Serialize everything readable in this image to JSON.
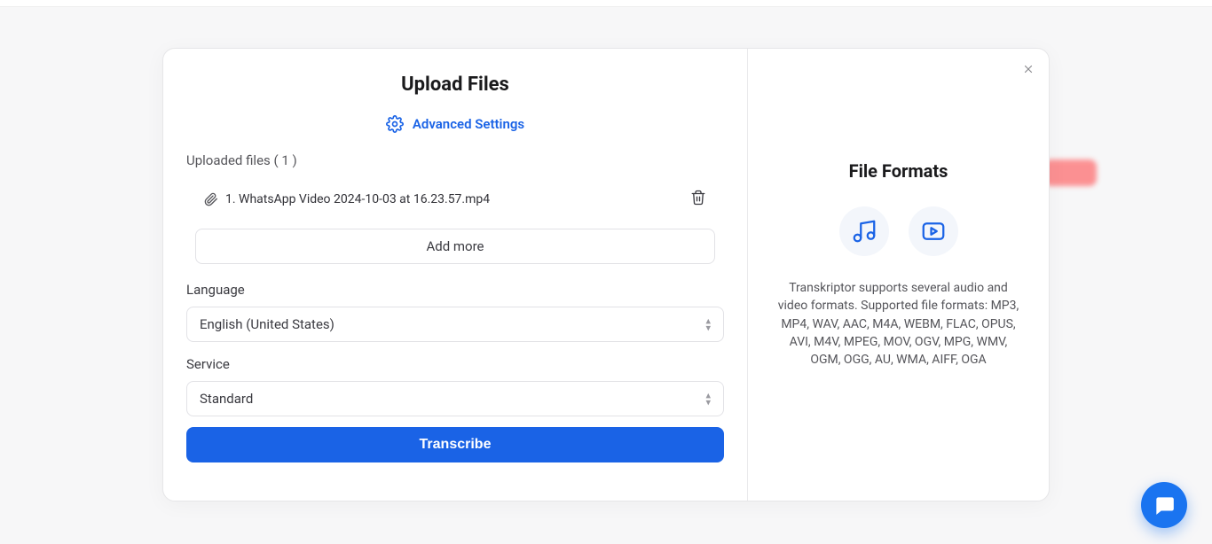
{
  "modal": {
    "title": "Upload Files",
    "advanced_settings": "Advanced Settings",
    "uploaded_files_label": "Uploaded files ( 1 )",
    "file_name": "1. WhatsApp Video 2024-10-03 at 16.23.57.mp4",
    "add_more": "Add more",
    "language_label": "Language",
    "language_value": "English (United States)",
    "service_label": "Service",
    "service_value": "Standard",
    "transcribe_button": "Transcribe"
  },
  "right_panel": {
    "title": "File Formats",
    "description": "Transkriptor supports several audio and video formats. Supported file formats: MP3, MP4, WAV, AAC, M4A, WEBM, FLAC, OPUS, AVI, M4V, MPEG, MOV, OGV, MPG, WMV, OGM, OGG, AU, WMA, AIFF, OGA"
  },
  "icons": {
    "gear": "gear-icon",
    "attachment": "attachment-icon",
    "trash": "trash-icon",
    "close": "close-icon",
    "audio": "audio-icon",
    "video": "video-icon",
    "chat": "chat-icon"
  }
}
